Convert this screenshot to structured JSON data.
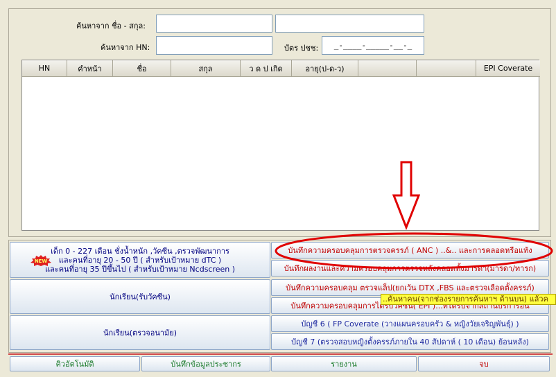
{
  "search": {
    "name_label": "ค้นหาจาก ชื่อ - สกุล:",
    "hn_label": "ค้นหาจาก HN:",
    "id_label": "บัตร ปชช:",
    "id_mask": "_-____-_____-__-_",
    "name_value": "",
    "surname_value": "",
    "hn_value": ""
  },
  "table": {
    "columns": [
      "HN",
      "คำหน้า",
      "ชื่อ",
      "สกุล",
      "ว ด ป เกิด",
      "อายุ(ป-ด-ว)",
      "",
      "",
      "EPI Coverate"
    ]
  },
  "buttons": {
    "child_line1": "เด็ก 0 - 227 เดือน ชั่งน้ำหนัก ,วัคซีน ,ตรวจพัฒนาการ",
    "child_line2": "และคนที่อายุ 20 - 50 ปี ( สำหรับเป้าหมาย dTC )",
    "child_line3": "และคนที่อายุ 35 ปีขึ้นไป ( สำหรับเป้าหมาย Ncdscreen )",
    "new_badge": "NEW",
    "anc": "บันทึกความครอบคลุมการตรวจครรภ์ ( ANC ) ..&.. และการคลอดหรือแท้ง",
    "postnatal": "บันทึกผลงานและความครอบคลุมการตรวจหลังคลอดทั้งมารดา(มารดา/ทารก)",
    "student_vaccine": "นักเรียน(รับวัคซีน)",
    "lab": "บันทึกความครอบคลุม ตรวจแล็ป(ยกเว้น DTX ,FBS และตรวจเลือดตั้งครรภ์)",
    "epi": "บันทึกความครอบคลุมการได้รับวัคซีน( EPI )...ที่ได้รับจากสถานบริการอื่น",
    "student_health": "นักเรียน(ตรวจอนามัย)",
    "account6": "บัญชี 6 ( FP Coverate (วางแผนครอบครัว & หญิงวัยเจริญพันธุ์) )",
    "account7": "บัญชี 7 (ตรวจสอบหญิงตั้งครรภ์ภายใน 40 สัปดาห์ ( 10 เดือน) ย้อนหลัง)"
  },
  "tooltip": "..ค้นหาคน(จากช่องรายการค้นหาฯ ด้านบน) แล้วค",
  "bottom": {
    "auto_queue": "คิวอัตโนมัติ",
    "population": "บันทึกข้อมูลประชากร",
    "report": "รายงาน",
    "end": "จบ"
  },
  "colors": {
    "annotation": "#e00000",
    "tooltip_bg": "#ffff40",
    "header_bg": "#dcd9cc"
  }
}
